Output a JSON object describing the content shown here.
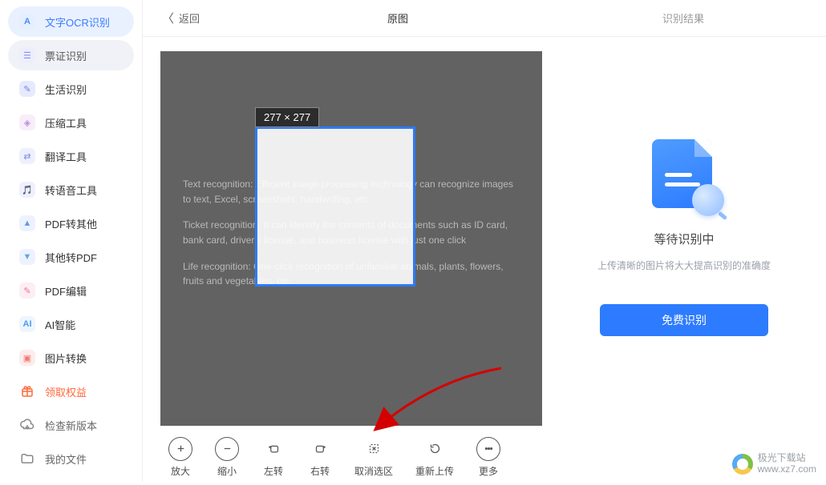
{
  "sidebar": {
    "items": [
      {
        "label": "文字OCR识别",
        "iconText": "A",
        "iconClass": "icon-ocr"
      },
      {
        "label": "票证识别",
        "iconText": "☰",
        "iconClass": "icon-ticket"
      },
      {
        "label": "生活识别",
        "iconText": "✎",
        "iconClass": "icon-life"
      },
      {
        "label": "压缩工具",
        "iconText": "◈",
        "iconClass": "icon-compress"
      },
      {
        "label": "翻译工具",
        "iconText": "⇄",
        "iconClass": "icon-translate"
      },
      {
        "label": "转语音工具",
        "iconText": "🎵",
        "iconClass": "icon-speech"
      },
      {
        "label": "PDF转其他",
        "iconText": "▲",
        "iconClass": "icon-pdf2"
      },
      {
        "label": "其他转PDF",
        "iconText": "▼",
        "iconClass": "icon-other2"
      },
      {
        "label": "PDF编辑",
        "iconText": "✎",
        "iconClass": "icon-pdfedit"
      },
      {
        "label": "AI智能",
        "iconText": "AI",
        "iconClass": "icon-ai"
      },
      {
        "label": "图片转换",
        "iconText": "▣",
        "iconClass": "icon-image"
      }
    ],
    "bottom": {
      "claim": "领取权益",
      "check_update": "检查新版本",
      "my_files": "我的文件"
    }
  },
  "topbar": {
    "back": "返回",
    "tab_original": "原图",
    "tab_result": "识别结果"
  },
  "stage": {
    "crop_size_badge": "277 × 277",
    "paragraphs": [
      "Text recognition: Efficient image processing technology can recognize images to text, Excel, screenshots, handwriting, etc",
      "Ticket recognition: It can identify the contents of documents such as ID card, bank card, driver's license, and business license with just one click",
      "Life recognition: One click recognition of unfamiliar animals, plants, flowers, fruits and vegetables, etc."
    ]
  },
  "toolbar": {
    "zoom_in": "放大",
    "zoom_out": "缩小",
    "rotate_left": "左转",
    "rotate_right": "右转",
    "cancel_selection": "取消选区",
    "reupload": "重新上传",
    "more": "更多"
  },
  "result_panel": {
    "title": "等待识别中",
    "subtitle": "上传清晰的图片将大大提高识别的准确度",
    "button": "免费识别"
  },
  "watermark": {
    "name": "极光下载站",
    "url": "www.xz7.com"
  }
}
